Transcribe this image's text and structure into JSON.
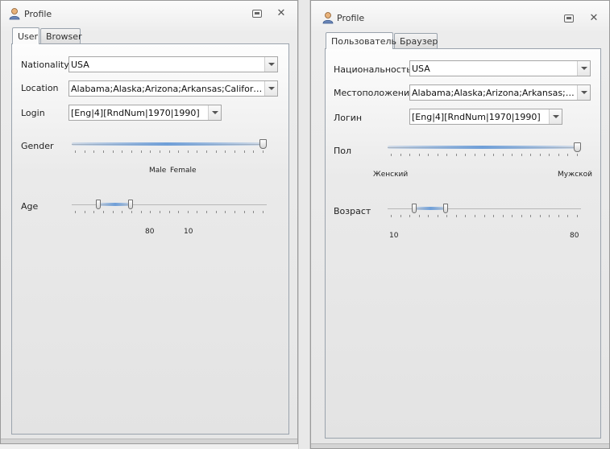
{
  "left_window": {
    "title": "Profile",
    "tabs": [
      "User",
      "Browser"
    ],
    "rows": {
      "nationality": {
        "label": "Nationality",
        "value": "USA"
      },
      "location": {
        "label": "Location",
        "value": "Alabama;Alaska;Arizona;Arkansas;California;Colorado"
      },
      "login": {
        "label": "Login",
        "value": "[Eng|4][RndNum|1970|1990]"
      },
      "gender": {
        "label": "Gender",
        "scale_left": "Male",
        "scale_right": "Female",
        "level": 1.0
      },
      "age": {
        "label": "Age",
        "scale_left": "80",
        "scale_right": "10",
        "range": [
          0.13,
          0.3
        ]
      }
    }
  },
  "right_window": {
    "title": "Profile",
    "tabs": [
      "Пользователь",
      "Браузер"
    ],
    "rows": {
      "nationality": {
        "label": "Национальность",
        "value": "USA"
      },
      "location": {
        "label": "Местоположение",
        "value": "Alabama;Alaska;Arizona;Arkansas;California;Colorado"
      },
      "login": {
        "label": "Логин",
        "value": "[Eng|4][RndNum|1970|1990]"
      },
      "gender": {
        "label": "Пол",
        "scale_left": "Женский",
        "scale_right": "Мужской",
        "level": 1.0
      },
      "age": {
        "label": "Возраст",
        "scale_left": "10",
        "scale_right": "80",
        "range": [
          0.13,
          0.3
        ]
      }
    }
  },
  "icons": {
    "profile": "user-profile-icon",
    "restore": "restore-window-icon",
    "close": "close-icon",
    "dropdown": "chevron-down-icon"
  },
  "colors": {
    "slider_fill": "#6f9fd8",
    "panel_border": "#9aa3ad"
  }
}
